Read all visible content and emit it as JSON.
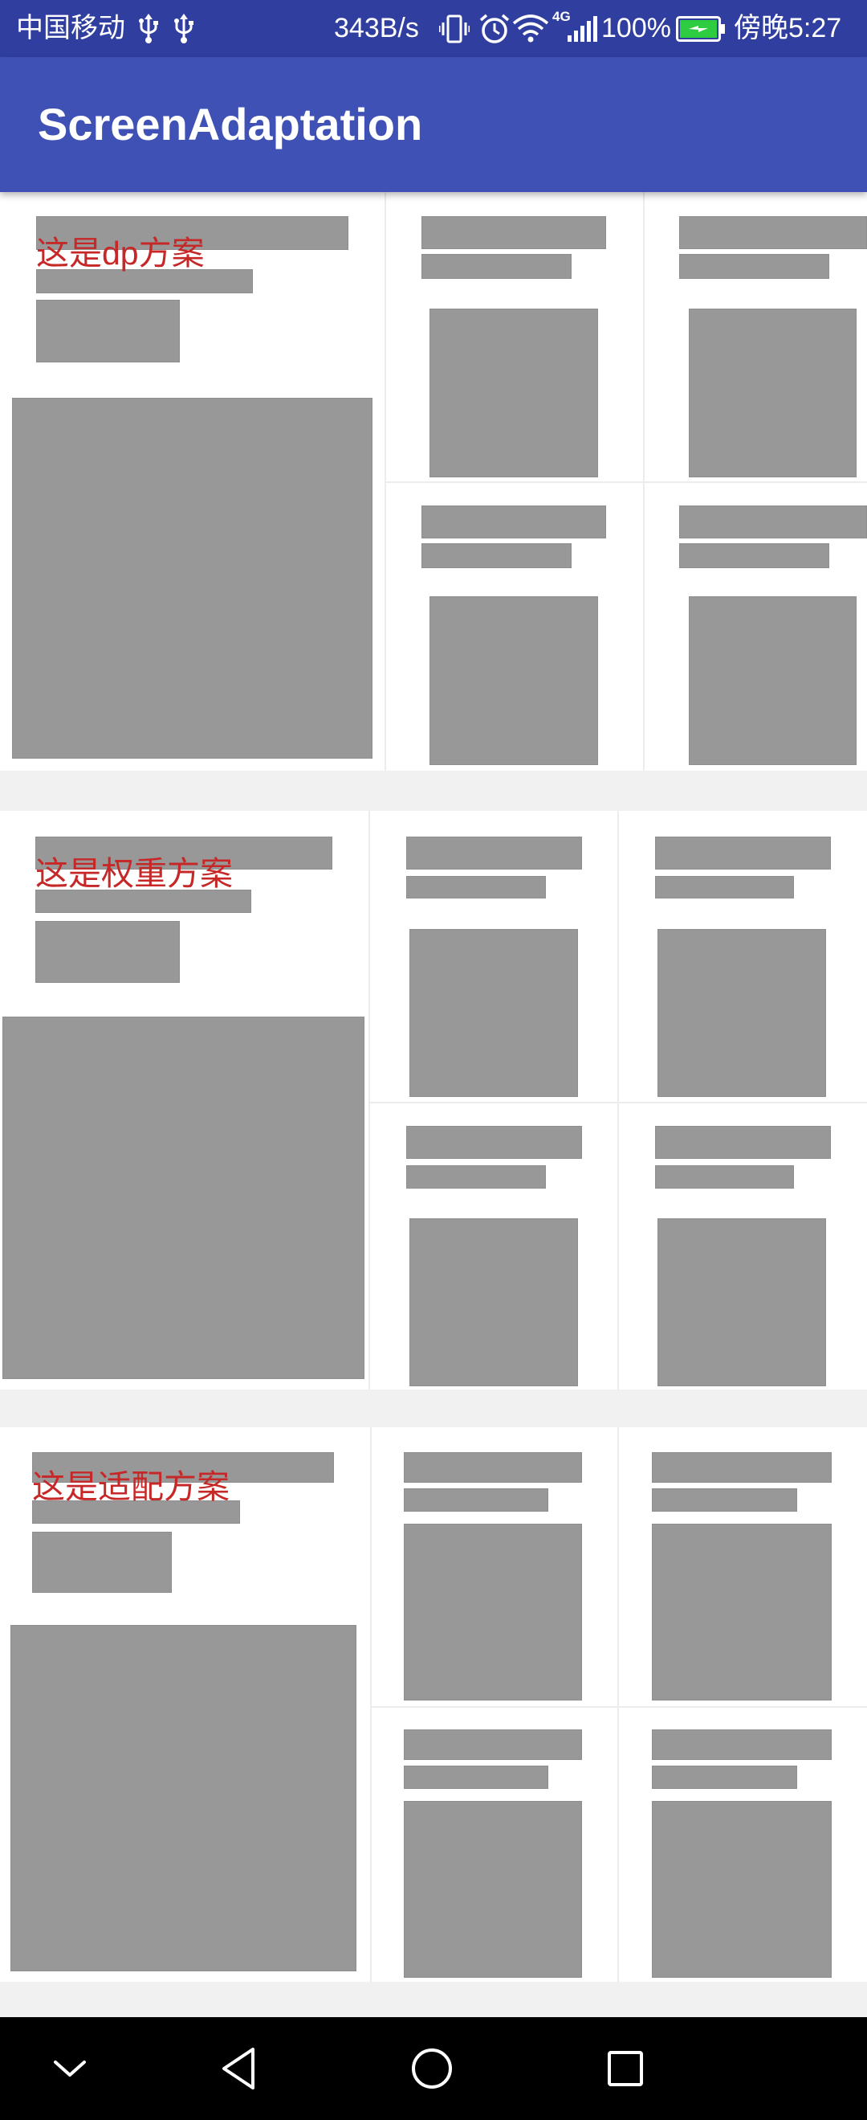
{
  "status_bar": {
    "carrier": "中国移动",
    "net_speed": "343B/s",
    "network_type": "4G",
    "battery": "100%",
    "time": "傍晚5:27",
    "icons": [
      "usb-icon",
      "usb-icon",
      "vibrate-icon",
      "alarm-icon",
      "wifi-icon",
      "signal-icon",
      "battery-charging-icon"
    ]
  },
  "app_bar": {
    "title": "ScreenAdaptation"
  },
  "sections": [
    {
      "label": "这是dp方案"
    },
    {
      "label": "这是权重方案"
    },
    {
      "label": "这是适配方案"
    }
  ],
  "nav_bar": {
    "icons": [
      "chevron-down-icon",
      "back-icon",
      "home-icon",
      "recents-icon"
    ]
  },
  "colors": {
    "status_bar": "#303F9F",
    "app_bar": "#3F51B5",
    "label_text": "#C62828",
    "placeholder": "#989898",
    "divider": "#ECECEC",
    "page_background": "#F1F1F1",
    "nav_bar": "#000000",
    "battery_fill": "#2ECC40"
  }
}
